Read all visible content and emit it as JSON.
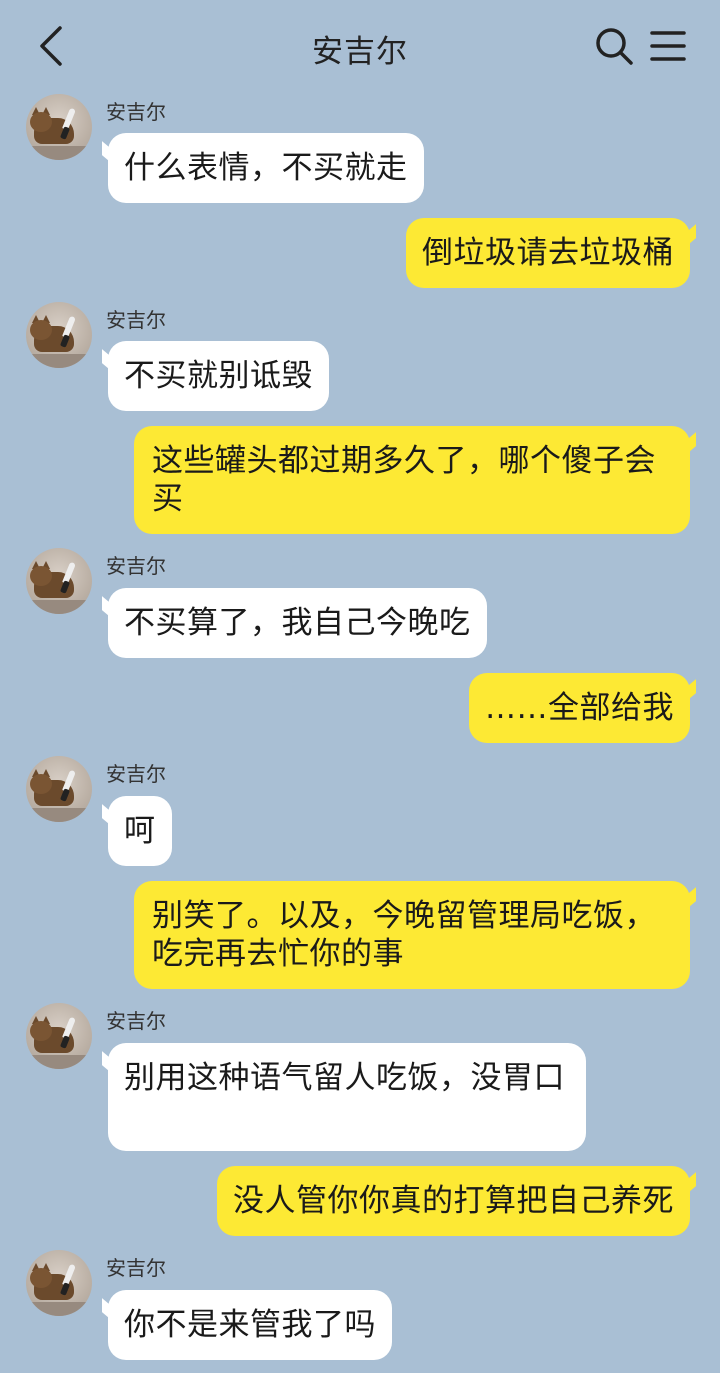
{
  "header": {
    "title": "安吉尔",
    "back_icon": "chevron-left-icon",
    "search_icon": "search-icon",
    "menu_icon": "menu-icon"
  },
  "colors": {
    "background": "#a9bfd4",
    "incoming_bubble": "#ffffff",
    "outgoing_bubble": "#fde934"
  },
  "messages": [
    {
      "from": "in",
      "sender": "安吉尔",
      "text": "什么表情，不买就走"
    },
    {
      "from": "out",
      "text": "倒垃圾请去垃圾桶"
    },
    {
      "from": "in",
      "sender": "安吉尔",
      "text": "不买就别诋毁"
    },
    {
      "from": "out",
      "text": "这些罐头都过期多久了，哪个傻子会买"
    },
    {
      "from": "in",
      "sender": "安吉尔",
      "text": "不买算了，我自己今晚吃"
    },
    {
      "from": "out",
      "text": "……全部给我"
    },
    {
      "from": "in",
      "sender": "安吉尔",
      "text": "呵"
    },
    {
      "from": "out",
      "text": "别笑了。以及，今晚留管理局吃饭，吃完再去忙你的事"
    },
    {
      "from": "in",
      "sender": "安吉尔",
      "text": "别用这种语气留人吃饭，没胃口"
    },
    {
      "from": "out",
      "text": "没人管你你真的打算把自己养死"
    },
    {
      "from": "in",
      "sender": "安吉尔",
      "text": "你不是来管我了吗"
    }
  ]
}
